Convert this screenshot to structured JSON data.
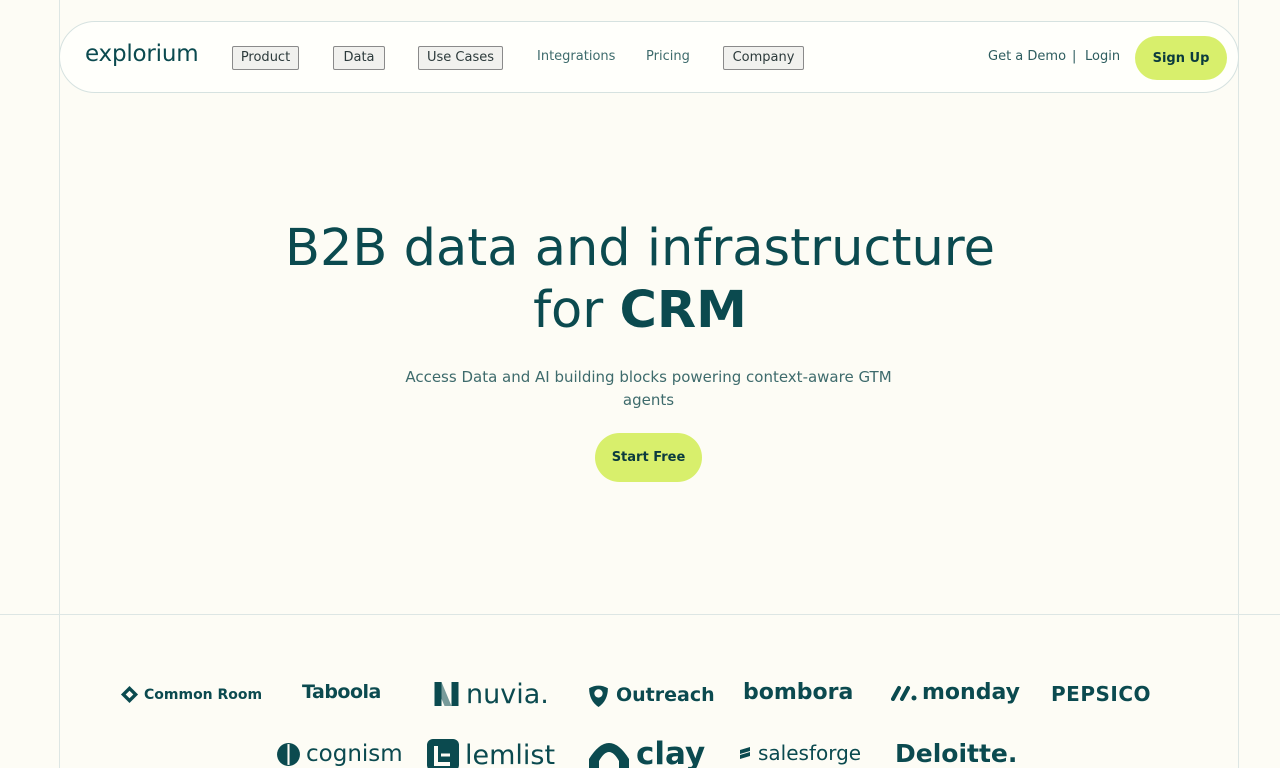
{
  "brand": {
    "name": "explorium"
  },
  "nav": {
    "items": [
      {
        "label": "Product"
      },
      {
        "label": "Data"
      },
      {
        "label": "Use Cases"
      },
      {
        "label": "Integrations"
      },
      {
        "label": "Pricing"
      },
      {
        "label": "Company"
      }
    ],
    "get_demo": "Get a Demo",
    "separator": "|",
    "login": "Login",
    "signup": "Sign Up"
  },
  "hero": {
    "title_line1": "B2B data and infrastructure",
    "title_line2_prefix": "for ",
    "title_line2_bold": "CRM",
    "subtitle": "Access Data and AI building blocks powering context-aware GTM agents",
    "cta": "Start Free"
  },
  "customers": [
    {
      "name": "Common Room",
      "icon": "diamond-icon"
    },
    {
      "name": "Taboola",
      "icon": ""
    },
    {
      "name": "nuvia.",
      "icon": "n-mark-icon"
    },
    {
      "name": "Outreach",
      "icon": "shield-icon"
    },
    {
      "name": "bombora",
      "icon": ""
    },
    {
      "name": "monday",
      "icon": "slash-dots-icon"
    },
    {
      "name": "PEPSICO",
      "icon": ""
    },
    {
      "name": "cognism",
      "icon": "circle-icon"
    },
    {
      "name": "lemlist",
      "icon": "square-l-icon"
    },
    {
      "name": "clay",
      "icon": "arch-icon"
    },
    {
      "name": "salesforge",
      "icon": "s-mark-icon"
    },
    {
      "name": "Deloitte.",
      "icon": ""
    }
  ],
  "colors": {
    "background": "#fdfcf5",
    "primary_text": "#0b4a4f",
    "accent": "#d8ef6c",
    "border": "#d6e2e0"
  }
}
